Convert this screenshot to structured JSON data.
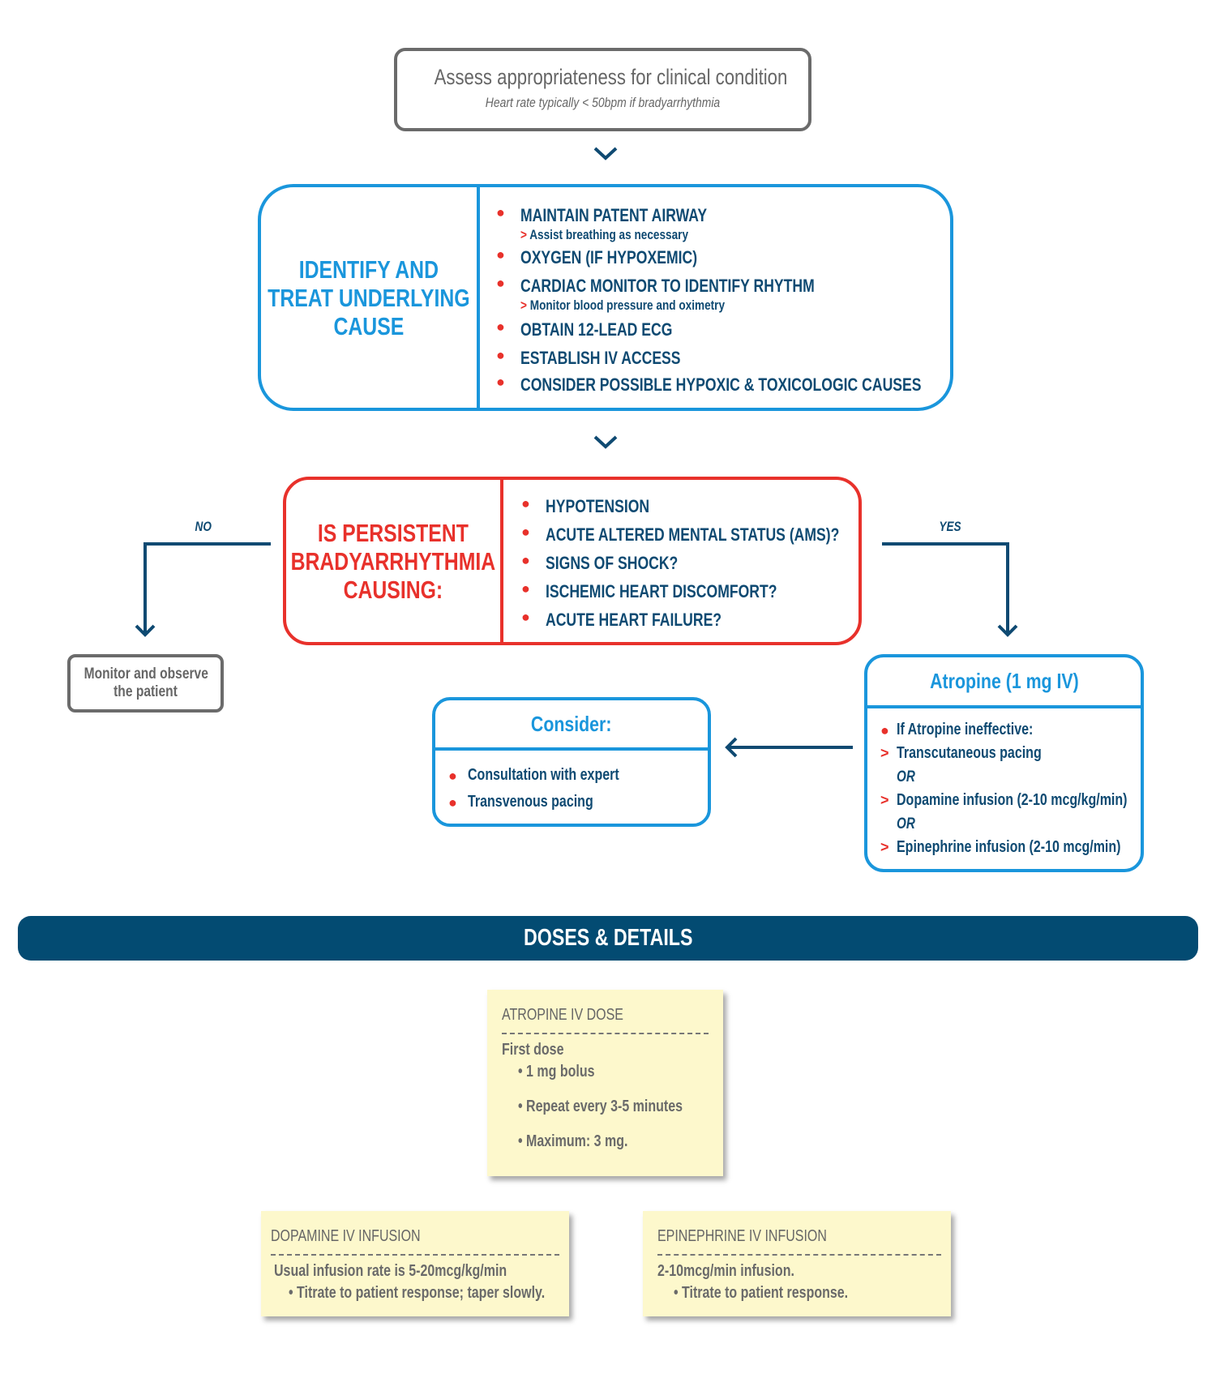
{
  "assess": {
    "title": "Assess appropriateness for clinical condition",
    "subtitle": "Heart rate typically < 50bpm if bradyarrhythmia"
  },
  "identify": {
    "heading": [
      "IDENTIFY AND",
      "TREAT UNDERLYING",
      "CAUSE"
    ],
    "items": [
      {
        "label": "MAINTAIN PATENT AIRWAY",
        "sub": "Assist breathing as necessary"
      },
      {
        "label": "OXYGEN (IF HYPOXEMIC)"
      },
      {
        "label": "CARDIAC MONITOR TO IDENTIFY RHYTHM",
        "sub": "Monitor blood pressure and oximetry"
      },
      {
        "label": "OBTAIN 12-LEAD ECG"
      },
      {
        "label": "ESTABLISH IV ACCESS"
      },
      {
        "label": "CONSIDER POSSIBLE HYPOXIC & TOXICOLOGIC CAUSES"
      }
    ]
  },
  "persistent": {
    "heading": [
      "IS PERSISTENT",
      "BRADYARRHYTHMIA",
      "CAUSING:"
    ],
    "items": [
      "HYPOTENSION",
      "ACUTE ALTERED MENTAL STATUS (AMS)?",
      "SIGNS OF SHOCK?",
      "ISCHEMIC HEART DISCOMFORT?",
      "ACUTE HEART FAILURE?"
    ]
  },
  "branches": {
    "no": "NO",
    "yes": "YES"
  },
  "monitor": {
    "lines": [
      "Monitor and observe",
      "the patient"
    ]
  },
  "atropine": {
    "title": "Atropine (1 mg IV)",
    "lead": "If Atropine ineffective:",
    "options": [
      "Transcutaneous pacing",
      "Dopamine infusion (2-10 mcg/kg/min)",
      "Epinephrine infusion (2-10 mcg/min)"
    ],
    "or_label": "OR"
  },
  "consider": {
    "title": "Consider:",
    "items": [
      "Consultation with expert",
      "Transvenous pacing"
    ]
  },
  "banner": {
    "title": "DOSES & DETAILS"
  },
  "cards": {
    "atropine": {
      "title": "ATROPINE IV DOSE",
      "intro": "First dose",
      "bullets": [
        "1 mg bolus",
        "Repeat every 3-5 minutes",
        "Maximum: 3 mg."
      ]
    },
    "dopamine": {
      "title": "DOPAMINE IV INFUSION",
      "intro": "Usual infusion rate is 5-20mcg/kg/min",
      "bullets": [
        "Titrate to patient response; taper slowly."
      ]
    },
    "epinephrine": {
      "title": "EPINEPHRINE IV INFUSION",
      "intro": "2-10mcg/min infusion.",
      "bullets": [
        "Titrate to patient response."
      ]
    }
  },
  "colors": {
    "blue": "#1a96dc",
    "red": "#e8312b",
    "navy": "#0f4a72",
    "gray": "#6b6b6b",
    "banner": "#034b72",
    "card": "#fdf8cc"
  }
}
